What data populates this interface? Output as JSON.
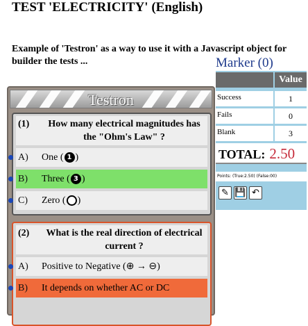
{
  "page": {
    "title": "TEST 'ELECTRICITY' (English)",
    "intro": "Example of 'Testron' as a way to use it with a Javascript object for builder the tests ..."
  },
  "testron": {
    "title": "Testron",
    "questions": [
      {
        "number": "(1)",
        "text": "How many electrical magnitudes has the \"Ohm's Law\" ?",
        "answers": [
          {
            "letter": "A)",
            "text": "One (",
            "mark": "1",
            "close": ")",
            "state": "normal"
          },
          {
            "letter": "B)",
            "text": "Three (",
            "mark": "3",
            "close": ")",
            "state": "selected"
          },
          {
            "letter": "C)",
            "text": "Zero (",
            "mark": "",
            "close": ")",
            "state": "normal"
          }
        ]
      },
      {
        "number": "(2)",
        "text": "What is the real direction of electrical current ?",
        "answers": [
          {
            "letter": "A)",
            "text": "Positive to Negative (⊕ → ⊖)",
            "state": "normal"
          },
          {
            "letter": "B)",
            "text": "It depends on whether AC or DC",
            "state": "wrong"
          }
        ]
      }
    ]
  },
  "marker": {
    "title": "Marker (0)",
    "value_header": "Value",
    "rows": [
      {
        "label": "Success",
        "value": "1"
      },
      {
        "label": "Fails",
        "value": "0"
      },
      {
        "label": "Blank",
        "value": "3"
      }
    ],
    "total_label": "TOTAL:",
    "total_value": "2.50",
    "points": "Points: (True:2.50) (False:00)",
    "tools": [
      {
        "name": "edit-icon",
        "glyph": "✎"
      },
      {
        "name": "save-icon",
        "glyph": "💾"
      },
      {
        "name": "undo-icon",
        "glyph": "↶"
      }
    ]
  },
  "colors": {
    "selected": "#7ee06a",
    "wrong": "#f06a3a",
    "marker_bg": "#9fcfe4",
    "total_value": "#c62b3a"
  }
}
